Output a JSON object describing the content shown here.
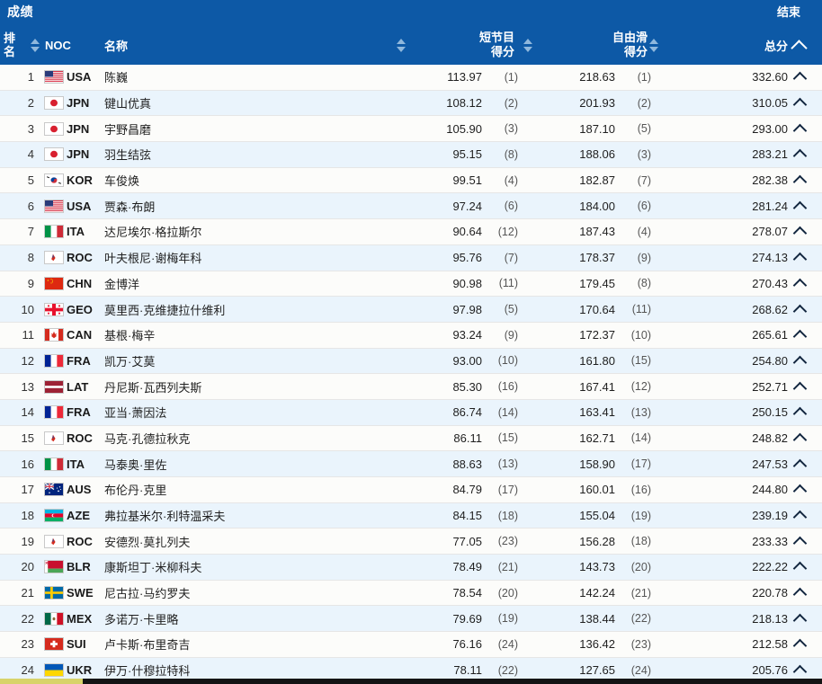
{
  "header": {
    "title": "成绩",
    "status": "结束"
  },
  "columns": {
    "rank": "排名",
    "noc": "NOC",
    "name": "名称",
    "short_program": {
      "line1": "短节目",
      "line2": "得分"
    },
    "free_skate": {
      "line1": "自由滑",
      "line2": "得分"
    },
    "total": "总分"
  },
  "icons": {
    "sort_rank": "sort-both-icon",
    "sort_name": "sort-both-icon",
    "sort_sp": "sort-both-icon",
    "sort_fs": "sort-both-icon",
    "sort_total": "chevron-up-icon",
    "row_expand": "chevron-up-icon"
  },
  "colors": {
    "header_blue": "#0d59a6",
    "row_alt": "#eaf4fc",
    "row_base": "#fcfcfa",
    "sort_arrow": "#8fb8dd",
    "text": "#1f1f1f"
  },
  "rows": [
    {
      "rank": "1",
      "noc": "USA",
      "flag": "flag-usa",
      "name": "陈巍",
      "sp": "113.97",
      "sp_rank": "(1)",
      "fs": "218.63",
      "fs_rank": "(1)",
      "total": "332.60"
    },
    {
      "rank": "2",
      "noc": "JPN",
      "flag": "flag-jpn",
      "name": "键山优真",
      "sp": "108.12",
      "sp_rank": "(2)",
      "fs": "201.93",
      "fs_rank": "(2)",
      "total": "310.05"
    },
    {
      "rank": "3",
      "noc": "JPN",
      "flag": "flag-jpn",
      "name": "宇野昌磨",
      "sp": "105.90",
      "sp_rank": "(3)",
      "fs": "187.10",
      "fs_rank": "(5)",
      "total": "293.00"
    },
    {
      "rank": "4",
      "noc": "JPN",
      "flag": "flag-jpn",
      "name": "羽生结弦",
      "sp": "95.15",
      "sp_rank": "(8)",
      "fs": "188.06",
      "fs_rank": "(3)",
      "total": "283.21"
    },
    {
      "rank": "5",
      "noc": "KOR",
      "flag": "flag-kor",
      "name": "车俊焕",
      "sp": "99.51",
      "sp_rank": "(4)",
      "fs": "182.87",
      "fs_rank": "(7)",
      "total": "282.38"
    },
    {
      "rank": "6",
      "noc": "USA",
      "flag": "flag-usa",
      "name": "贾森·布朗",
      "sp": "97.24",
      "sp_rank": "(6)",
      "fs": "184.00",
      "fs_rank": "(6)",
      "total": "281.24"
    },
    {
      "rank": "7",
      "noc": "ITA",
      "flag": "flag-ita",
      "name": "达尼埃尔·格拉斯尔",
      "sp": "90.64",
      "sp_rank": "(12)",
      "fs": "187.43",
      "fs_rank": "(4)",
      "total": "278.07"
    },
    {
      "rank": "8",
      "noc": "ROC",
      "flag": "flag-roc",
      "name": "叶夫根尼·谢梅年科",
      "sp": "95.76",
      "sp_rank": "(7)",
      "fs": "178.37",
      "fs_rank": "(9)",
      "total": "274.13"
    },
    {
      "rank": "9",
      "noc": "CHN",
      "flag": "flag-chn",
      "name": "金博洋",
      "sp": "90.98",
      "sp_rank": "(11)",
      "fs": "179.45",
      "fs_rank": "(8)",
      "total": "270.43"
    },
    {
      "rank": "10",
      "noc": "GEO",
      "flag": "flag-geo",
      "name": "莫里西·克维捷拉什维利",
      "sp": "97.98",
      "sp_rank": "(5)",
      "fs": "170.64",
      "fs_rank": "(11)",
      "total": "268.62"
    },
    {
      "rank": "11",
      "noc": "CAN",
      "flag": "flag-can",
      "name": "基根·梅辛",
      "sp": "93.24",
      "sp_rank": "(9)",
      "fs": "172.37",
      "fs_rank": "(10)",
      "total": "265.61"
    },
    {
      "rank": "12",
      "noc": "FRA",
      "flag": "flag-fra",
      "name": "凯万·艾莫",
      "sp": "93.00",
      "sp_rank": "(10)",
      "fs": "161.80",
      "fs_rank": "(15)",
      "total": "254.80"
    },
    {
      "rank": "13",
      "noc": "LAT",
      "flag": "flag-lat",
      "name": "丹尼斯·瓦西列夫斯",
      "sp": "85.30",
      "sp_rank": "(16)",
      "fs": "167.41",
      "fs_rank": "(12)",
      "total": "252.71"
    },
    {
      "rank": "14",
      "noc": "FRA",
      "flag": "flag-fra",
      "name": "亚当·萧因法",
      "sp": "86.74",
      "sp_rank": "(14)",
      "fs": "163.41",
      "fs_rank": "(13)",
      "total": "250.15"
    },
    {
      "rank": "15",
      "noc": "ROC",
      "flag": "flag-roc",
      "name": "马克·孔德拉秋克",
      "sp": "86.11",
      "sp_rank": "(15)",
      "fs": "162.71",
      "fs_rank": "(14)",
      "total": "248.82"
    },
    {
      "rank": "16",
      "noc": "ITA",
      "flag": "flag-ita",
      "name": "马泰奥·里佐",
      "sp": "88.63",
      "sp_rank": "(13)",
      "fs": "158.90",
      "fs_rank": "(17)",
      "total": "247.53"
    },
    {
      "rank": "17",
      "noc": "AUS",
      "flag": "flag-aus",
      "name": "布伦丹·克里",
      "sp": "84.79",
      "sp_rank": "(17)",
      "fs": "160.01",
      "fs_rank": "(16)",
      "total": "244.80"
    },
    {
      "rank": "18",
      "noc": "AZE",
      "flag": "flag-aze",
      "name": "弗拉基米尔·利特温采夫",
      "sp": "84.15",
      "sp_rank": "(18)",
      "fs": "155.04",
      "fs_rank": "(19)",
      "total": "239.19"
    },
    {
      "rank": "19",
      "noc": "ROC",
      "flag": "flag-roc",
      "name": "安德烈·莫扎列夫",
      "sp": "77.05",
      "sp_rank": "(23)",
      "fs": "156.28",
      "fs_rank": "(18)",
      "total": "233.33"
    },
    {
      "rank": "20",
      "noc": "BLR",
      "flag": "flag-blr",
      "name": "康斯坦丁·米柳科夫",
      "sp": "78.49",
      "sp_rank": "(21)",
      "fs": "143.73",
      "fs_rank": "(20)",
      "total": "222.22"
    },
    {
      "rank": "21",
      "noc": "SWE",
      "flag": "flag-swe",
      "name": "尼古拉·马约罗夫",
      "sp": "78.54",
      "sp_rank": "(20)",
      "fs": "142.24",
      "fs_rank": "(21)",
      "total": "220.78"
    },
    {
      "rank": "22",
      "noc": "MEX",
      "flag": "flag-mex",
      "name": "多诺万·卡里略",
      "sp": "79.69",
      "sp_rank": "(19)",
      "fs": "138.44",
      "fs_rank": "(22)",
      "total": "218.13"
    },
    {
      "rank": "23",
      "noc": "SUI",
      "flag": "flag-sui",
      "name": "卢卡斯·布里奇吉",
      "sp": "76.16",
      "sp_rank": "(24)",
      "fs": "136.42",
      "fs_rank": "(23)",
      "total": "212.58"
    },
    {
      "rank": "24",
      "noc": "UKR",
      "flag": "flag-ukr",
      "name": "伊万·什穆拉特科",
      "sp": "78.11",
      "sp_rank": "(22)",
      "fs": "127.65",
      "fs_rank": "(24)",
      "total": "205.76"
    }
  ]
}
